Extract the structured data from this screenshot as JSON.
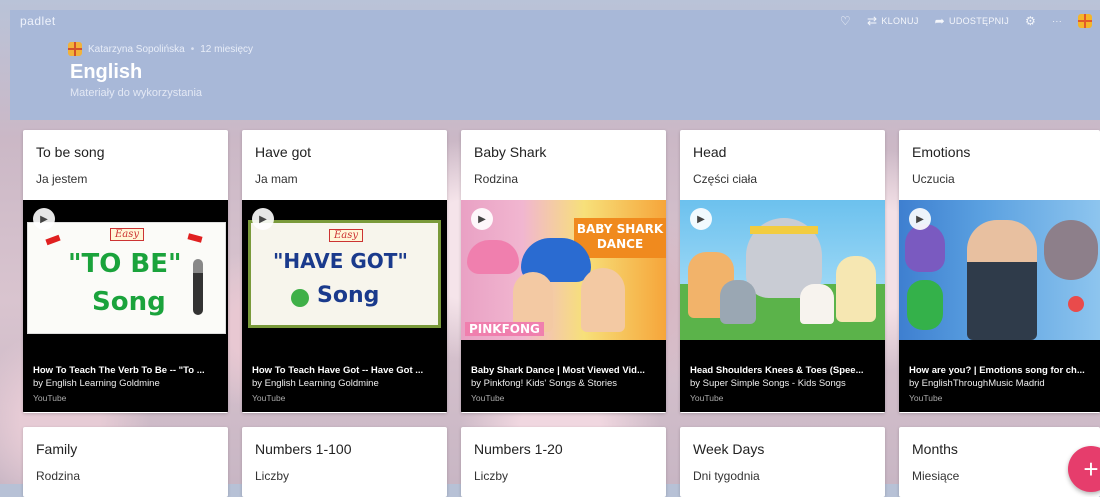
{
  "app": {
    "logo": "padlet"
  },
  "toolbar": {
    "heart_icon": "heart-icon",
    "clone_label": "KLONUJ",
    "share_label": "UDOSTĘPNIJ",
    "more_label": "···"
  },
  "board": {
    "author": "Katarzyna Sopolińska",
    "age": "12 miesięcy",
    "separator": "•",
    "title": "English",
    "subtitle": "Materiały do wykorzystania"
  },
  "cards": [
    {
      "title": "To be  song",
      "subtitle": "Ja jestem",
      "thumb": {
        "easy": "Easy",
        "line1": "\"TO BE\"",
        "line2": "Song"
      },
      "video_title": "How To Teach The Verb To Be -- \"To ...",
      "video_by": "by English Learning Goldmine",
      "video_source": "YouTube"
    },
    {
      "title": "Have got",
      "subtitle": "Ja mam",
      "thumb": {
        "easy": "Easy",
        "line1": "\"HAVE GOT\"",
        "line2": "Song"
      },
      "video_title": "How To Teach Have Got -- Have Got ...",
      "video_by": "by English Learning Goldmine",
      "video_source": "YouTube"
    },
    {
      "title": "Baby Shark",
      "subtitle": "Rodzina",
      "thumb": {
        "banner": "BABY SHARK DANCE",
        "brand": "PINKFONG"
      },
      "video_title": "Baby Shark Dance | Most Viewed Vid...",
      "video_by": "by Pinkfong! Kids' Songs & Stories",
      "video_source": "YouTube"
    },
    {
      "title": "Head",
      "subtitle": "Części ciała",
      "video_title": "Head Shoulders Knees & Toes (Spee...",
      "video_by": "by Super Simple Songs - Kids Songs",
      "video_source": "YouTube"
    },
    {
      "title": "Emotions",
      "subtitle": "Uczucia",
      "video_title": "How are you? | Emotions song for ch...",
      "video_by": "by EnglishThroughMusic Madrid",
      "video_source": "YouTube"
    }
  ],
  "cards_row2": [
    {
      "title": "Family",
      "subtitle": "Rodzina"
    },
    {
      "title": "Numbers 1-100",
      "subtitle": "Liczby"
    },
    {
      "title": "Numbers 1-20",
      "subtitle": "Liczby"
    },
    {
      "title": "Week Days",
      "subtitle": "Dni tygodnia"
    },
    {
      "title": "Months",
      "subtitle": "Miesiące"
    }
  ],
  "fab": {
    "label": "+"
  },
  "colors": {
    "header": "#a8b8d8",
    "fab": "#e63d6c"
  }
}
